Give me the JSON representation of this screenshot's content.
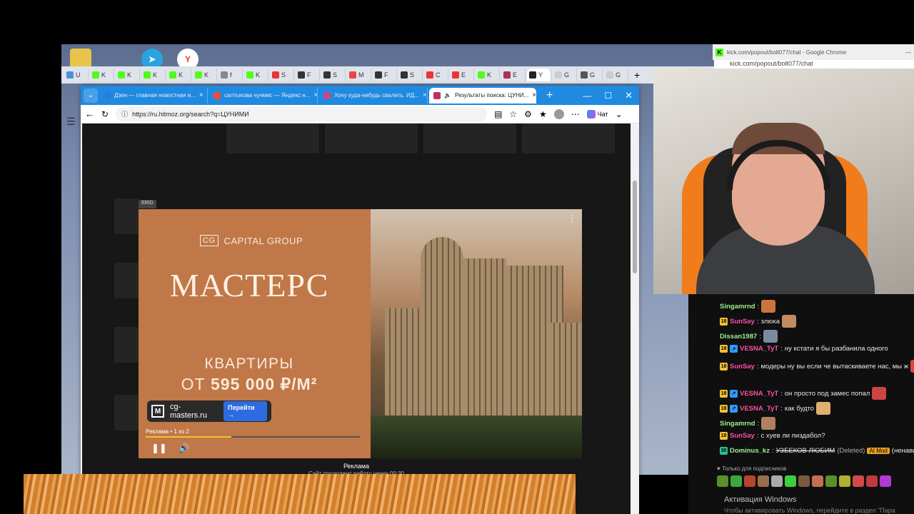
{
  "chrome_tabs": [
    "U",
    "K",
    "K",
    "K",
    "K",
    "K",
    "f",
    "K",
    "S",
    "F",
    "S",
    "M",
    "F",
    "S",
    "C",
    "E",
    "K",
    "E",
    "Y",
    "G",
    "G",
    "G"
  ],
  "chrome_new_tab": "+",
  "edge": {
    "tabs": [
      {
        "label": "Дзен — главная новостная и..."
      },
      {
        "label": "салтыкова чучмис — Яндекс н..."
      },
      {
        "label": "Хочу куда-нибудь свалить. ИД..."
      },
      {
        "label": "Результаты поиска: ЦУНИ..."
      }
    ],
    "new_tab": "+",
    "url": "https://ru.hitmoz.org/search?q=ЦУНИМИ",
    "chat_button": "Чат"
  },
  "ad": {
    "erid": "ERID",
    "brand_logo": "CG",
    "brand": "CAPITAL GROUP",
    "title": "МАСТЕРС",
    "line1": "КВАРТИРЫ",
    "line2_prefix": "ОТ",
    "line2_price": "595 000 ₽/М²",
    "domain": "cg-masters.ru",
    "goto_label": "Перейти →",
    "counter": "Реклама • 1 из 2",
    "progress": 0.4,
    "below_label": "Реклама",
    "below_sub": "Сайт продолжит работу через 00:30"
  },
  "kick": {
    "window_title": "kick.com/popout/bolt077/chat - Google Chrome",
    "url": "kick.com/popout/bolt077/chat"
  },
  "chat": {
    "messages": [
      {
        "nick": "Singamrnd",
        "text": "",
        "color": "#9ef08e",
        "badges": []
      },
      {
        "nick": "SunSay",
        "text": "злюка",
        "color": "#ff4fa0",
        "badges": [
          "18"
        ]
      },
      {
        "nick": "Dissan1987",
        "text": "",
        "color": "#9ef08e",
        "badges": []
      },
      {
        "nick": "VESNA_TyT",
        "text": "ну кстати я бы разбанила одного",
        "color": "#ff4fa0",
        "badges": [
          "18",
          "↗"
        ]
      },
      {
        "nick": "SunSay",
        "text": "модеры ну вы если че вытаскиваете нас, мы ж",
        "color": "#ff4fa0",
        "badges": [
          "18"
        ]
      },
      {
        "nick": "VESNA_TyT",
        "text": "он просто под замес попал",
        "color": "#ff4fa0",
        "badges": [
          "18",
          "↗"
        ]
      },
      {
        "nick": "VESNA_TyT",
        "text": "как будто",
        "color": "#ff4fa0",
        "badges": [
          "18",
          "↗"
        ]
      },
      {
        "nick": "Singamrnd",
        "text": "",
        "color": "#9ef08e",
        "badges": []
      },
      {
        "nick": "SunSay",
        "text": "с хуев ли пиздабол?",
        "color": "#ff4fa0",
        "badges": [
          "18"
        ]
      },
      {
        "nick": "Dominus_kz",
        "text": "УЗБЕКОВ ЛЮБИМ",
        "deleted": "(Deleted)",
        "mod": "AI Mod",
        "tail": "(ненавис",
        "color": "#9ef08e",
        "badges": [
          "30"
        ]
      }
    ],
    "sub_only": "Только для подписчиков",
    "windows_activation": "Активация Windows",
    "windows_activation_sub": "Чтобы активировать Windows, перейдите в раздел \"Пара"
  },
  "colors": {
    "edge_accent": "#1f8ae0",
    "kick_green": "#53fc18",
    "ad_orange": "#c07848",
    "goto_blue": "#2c6be0"
  }
}
